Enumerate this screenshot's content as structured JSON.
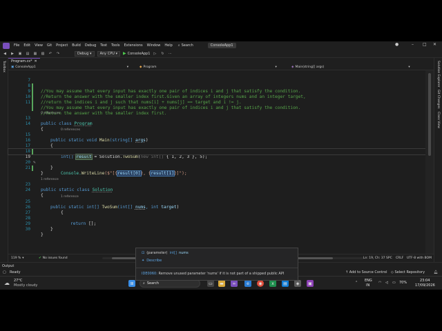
{
  "menubar": {
    "items": [
      "File",
      "Edit",
      "View",
      "Git",
      "Project",
      "Build",
      "Debug",
      "Test",
      "Tools",
      "Extensions",
      "Window",
      "Help"
    ],
    "search_label": "Search",
    "solution_name": "ConsoleApp1"
  },
  "toolbar": {
    "config": "Debug",
    "platform": "Any CPU",
    "run_target": "ConsoleApp1"
  },
  "left_panels": [
    "Toolbox"
  ],
  "right_panels": [
    "Solution Explorer",
    "Git Changes",
    "Class View"
  ],
  "tabs": [
    {
      "label": "Program.cs*"
    }
  ],
  "navbar": {
    "project": "ConsoleApp1",
    "class": "Program",
    "member": "Main(string[] args)"
  },
  "code": {
    "line_numbers": {
      "l7": "7",
      "l8": "8",
      "l9": "9",
      "l10": "10",
      "l11": "11",
      "l13": "13",
      "l14": "14",
      "l15": "15",
      "l16": "16",
      "l17": "17",
      "l18": "18",
      "l19": "19",
      "l20": "20",
      "l21": "21",
      "l23": "23",
      "l24": "24",
      "l25": "25",
      "l26": "26",
      "l27": "27",
      "l28": "28",
      "l29": "29",
      "l30": "30"
    },
    "comment_7": "//You may assume that every input has exactly one pair of indices i and j that satisfy the condition.",
    "comment_8": "//Return the answer with the smaller index first.Given an array of integers nums and an integer target,",
    "comment_9": "//return the indices i and j such that nums[i] + nums[j] == target and i != j.",
    "comment_10": "//You may assume that every input has exactly one pair of indices i and j that satisfy the condition.",
    "comment_11": "//Return the answer with the smaller index first.",
    "refs_0a": "0 references",
    "refs_0b": "0 references",
    "refs_1a": "1 reference",
    "refs_1b": "1 reference",
    "kw_public": "public",
    "kw_class": "class",
    "class_program": "Program",
    "brace_open": "{",
    "brace_close": "}",
    "kw_static": "static",
    "kw_void": "void",
    "fn_main": "Main",
    "main_params": "(string[] ",
    "main_args": "args",
    "main_close": ")",
    "l17_type": "int[] ",
    "l17_var": "result",
    "l17_assign": " = Solution.",
    "l17_call": "TwoSum",
    "l17_paren": "(",
    "l17_new": "new int[]",
    "l17_arr": " { 1, 2, 3 }, 5);",
    "l19_console": "Console.",
    "l19_write": "WriteLine",
    "l19_str1": "($\"[{",
    "l19_res0": "result[0]",
    "l19_mid": "}, {",
    "l19_res1": "result[1]",
    "l19_end": "}]\");",
    "class_solution": "Solution",
    "l25_sig1": "int[] ",
    "l25_name": "TwoSum",
    "l25_sig2": "(int[] ",
    "l25_nums": "nums",
    "l25_sig3": ", int ",
    "l25_target": "target",
    "l25_sig4": ")",
    "l28_return": "return",
    "l28_rest": " [];"
  },
  "tooltip": {
    "param_kind": "(parameter)",
    "param_type": "int[]",
    "param_name": "nums",
    "describe": "Describe",
    "diag_code": "IDE0060:",
    "diag_text": "Remove unused parameter 'nums' if it is not part of a shipped public API"
  },
  "status": {
    "zoom": "119 %",
    "issues": "No issues found",
    "position": "Ln: 19, Ch: 37",
    "whitespace": "SPC",
    "line_ending": "CRLF",
    "encoding": "UTF-8 with BOM"
  },
  "output_tab": "Output",
  "ready": "Ready",
  "add_source": "Add to Source Control",
  "select_repo": "Select Repository",
  "taskbar": {
    "weather_temp": "27°C",
    "weather_desc": "Mostly cloudy",
    "search": "Search",
    "lang1": "ENG",
    "lang2": "IN",
    "battery": "70%",
    "time": "23:04",
    "date": "17/09/2026"
  }
}
